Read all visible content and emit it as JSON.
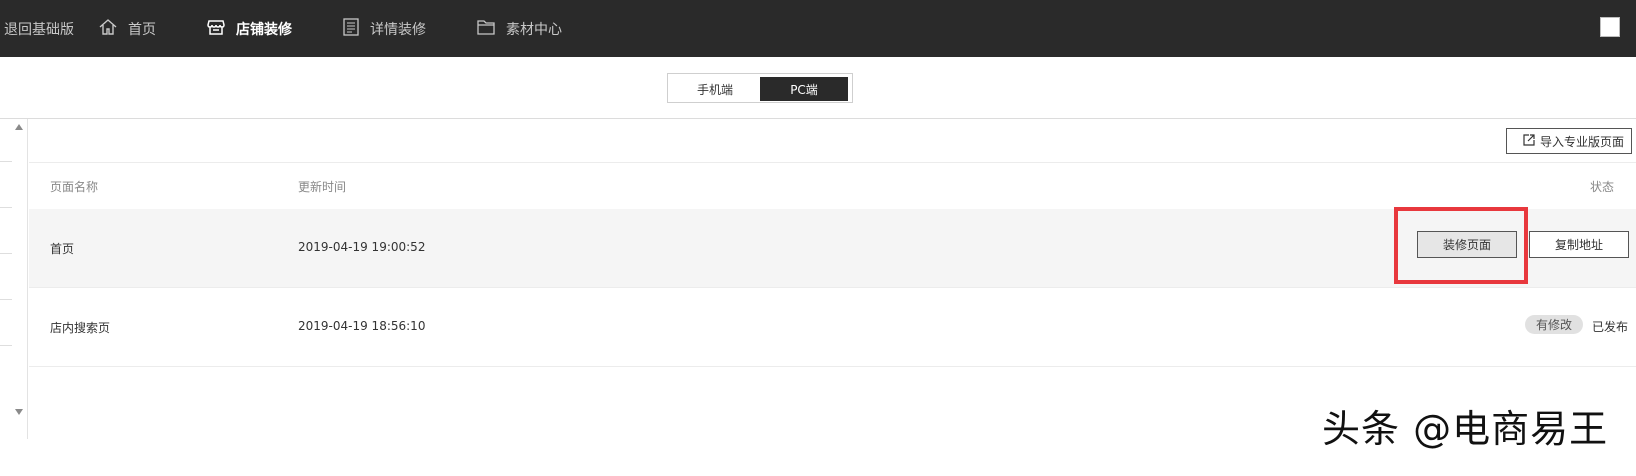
{
  "topbar": {
    "back_label": "退回基础版",
    "items": [
      {
        "label": "首页",
        "icon": "home-icon"
      },
      {
        "label": "店铺装修",
        "icon": "store-icon",
        "active": true
      },
      {
        "label": "详情装修",
        "icon": "document-icon"
      },
      {
        "label": "素材中心",
        "icon": "folder-icon"
      }
    ]
  },
  "device_toggle": {
    "mobile_label": "手机端",
    "pc_label": "PC端",
    "selected": "PC端"
  },
  "toolbar": {
    "import_label": "导入专业版页面",
    "import_icon": "export-icon"
  },
  "table": {
    "headers": {
      "name": "页面名称",
      "time": "更新时间",
      "status": "状态"
    },
    "rows": [
      {
        "name": "首页",
        "time": "2019-04-19 19:00:52",
        "action1": "装修页面",
        "action2": "复制地址"
      },
      {
        "name": "店内搜索页",
        "time": "2019-04-19 18:56:10",
        "badge": "有修改",
        "status": "已发布"
      }
    ]
  },
  "colors": {
    "topbar": "#2a2a2a",
    "highlight": "#e8383d",
    "row_hover": "#f5f5f5"
  },
  "watermark": "头条 @电商易王"
}
